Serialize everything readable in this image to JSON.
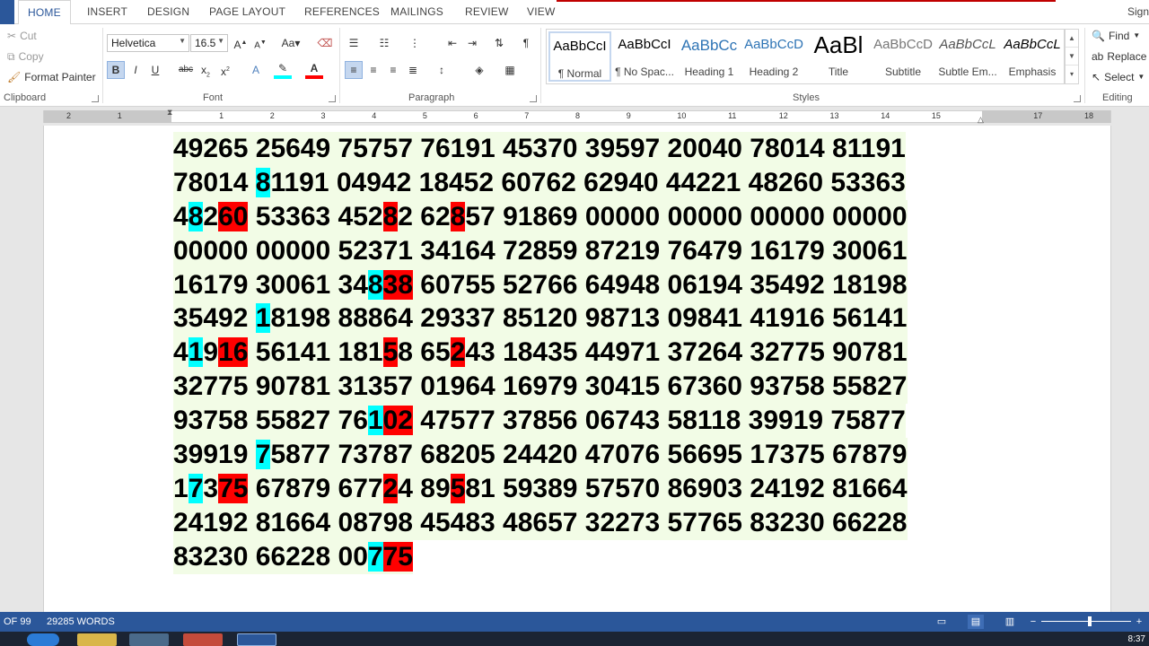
{
  "ribbon_tabs": [
    "HOME",
    "INSERT",
    "DESIGN",
    "PAGE LAYOUT",
    "REFERENCES",
    "MAILINGS",
    "REVIEW",
    "VIEW"
  ],
  "sign_in": "Sign",
  "clipboard": {
    "cut": "Cut",
    "copy": "Copy",
    "format_painter": "Format Painter",
    "label": "Clipboard"
  },
  "font": {
    "name": "Helvetica",
    "size": "16.5",
    "label": "Font"
  },
  "paragraph": {
    "label": "Paragraph"
  },
  "styles": {
    "label": "Styles",
    "items": [
      {
        "sample": "AaBbCcI",
        "name": "¶ Normal"
      },
      {
        "sample": "AaBbCcI",
        "name": "¶ No Spac..."
      },
      {
        "sample": "AaBbCc",
        "name": "Heading 1"
      },
      {
        "sample": "AaBbCcD",
        "name": "Heading 2"
      },
      {
        "sample": "AaBl",
        "name": "Title"
      },
      {
        "sample": "AaBbCcD",
        "name": "Subtitle"
      },
      {
        "sample": "AaBbCcL",
        "name": "Subtle Em..."
      },
      {
        "sample": "AaBbCcL",
        "name": "Emphasis"
      }
    ]
  },
  "editing": {
    "find": "Find",
    "replace": "Replace",
    "select": "Select",
    "label": "Editing"
  },
  "ruler_numbers": [
    "2",
    "1",
    "",
    "1",
    "2",
    "3",
    "4",
    "5",
    "6",
    "7",
    "8",
    "9",
    "10",
    "11",
    "12",
    "13",
    "14",
    "15",
    "",
    "17",
    "18"
  ],
  "document": {
    "lines": [
      [
        {
          "t": "49265 25649 75757 76191 45370 39597 20040 78014 81191",
          "h": ""
        }
      ],
      [
        {
          "t": "78014 ",
          "h": ""
        },
        {
          "t": "8",
          "h": "c"
        },
        {
          "t": "1191 04942 18452 60762 62940 44221 48260 53363",
          "h": ""
        }
      ],
      [
        {
          "t": "4",
          "h": ""
        },
        {
          "t": "8",
          "h": "c"
        },
        {
          "t": "2",
          "h": ""
        },
        {
          "t": "60",
          "h": "r"
        },
        {
          "t": " 53363 452",
          "h": ""
        },
        {
          "t": "8",
          "h": "r"
        },
        {
          "t": "2 62",
          "h": ""
        },
        {
          "t": "8",
          "h": "r"
        },
        {
          "t": "57 91869 00000 00000 00000 00000",
          "h": ""
        }
      ],
      [
        {
          "t": "00000 00000 52371 34164 72859 87219 76479 16179 30061",
          "h": ""
        }
      ],
      [
        {
          "t": "16179 30061 34",
          "h": ""
        },
        {
          "t": "8",
          "h": "c"
        },
        {
          "t": "38",
          "h": "r"
        },
        {
          "t": " 60755 52766 64948 06194 35492 18198",
          "h": ""
        }
      ],
      [
        {
          "t": "35492 ",
          "h": ""
        },
        {
          "t": "1",
          "h": "c"
        },
        {
          "t": "8198 88864 29337 85120 98713 09841 41916 56141",
          "h": ""
        }
      ],
      [
        {
          "t": "4",
          "h": ""
        },
        {
          "t": "1",
          "h": "c"
        },
        {
          "t": "9",
          "h": ""
        },
        {
          "t": "16",
          "h": "r"
        },
        {
          "t": " 56141 181",
          "h": ""
        },
        {
          "t": "5",
          "h": "r"
        },
        {
          "t": "8 65",
          "h": ""
        },
        {
          "t": "2",
          "h": "r"
        },
        {
          "t": "43 18435 44971 37264 32775 90781",
          "h": ""
        }
      ],
      [
        {
          "t": "32775 90781 31357 01964 16979 30415 67360 93758 55827",
          "h": ""
        }
      ],
      [
        {
          "t": "93758 55827 76",
          "h": ""
        },
        {
          "t": "1",
          "h": "c"
        },
        {
          "t": "02",
          "h": "r"
        },
        {
          "t": " 47577 37856 06743 58118 39919 75877",
          "h": ""
        }
      ],
      [
        {
          "t": "39919 ",
          "h": ""
        },
        {
          "t": "7",
          "h": "c"
        },
        {
          "t": "5877 73787 68205 24420 47076 56695 17375 67879",
          "h": ""
        }
      ],
      [
        {
          "t": "1",
          "h": ""
        },
        {
          "t": "7",
          "h": "c"
        },
        {
          "t": "3",
          "h": ""
        },
        {
          "t": "75",
          "h": "r"
        },
        {
          "t": " 67879 677",
          "h": ""
        },
        {
          "t": "2",
          "h": "r"
        },
        {
          "t": "4 89",
          "h": ""
        },
        {
          "t": "5",
          "h": "r"
        },
        {
          "t": "81 59389 57570 86903 24192 81664",
          "h": ""
        }
      ],
      [
        {
          "t": "24192 81664 08798 45483 48657 32273 57765 83230 66228",
          "h": ""
        }
      ],
      [
        {
          "t": "83230 66228 00",
          "h": ""
        },
        {
          "t": "7",
          "h": "c"
        },
        {
          "t": "75",
          "h": "r"
        }
      ]
    ]
  },
  "status": {
    "page": "OF 99",
    "words": "29285 WORDS"
  },
  "taskbar": {
    "clock": "8:37"
  },
  "colors": {
    "accent": "#2b579a",
    "highlight_cyan": "#00ffff",
    "highlight_red": "#ff0000",
    "line_shading": "#f2fce6"
  }
}
